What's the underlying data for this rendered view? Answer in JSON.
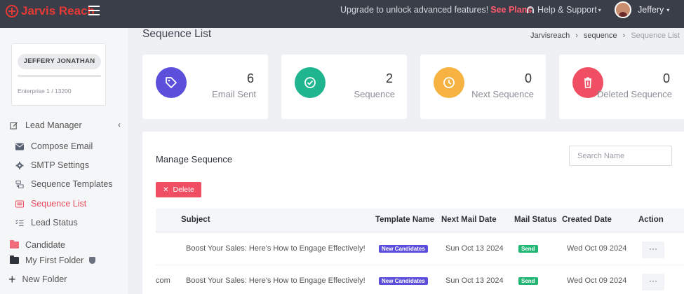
{
  "header": {
    "brand_name": "Jarvis Reach",
    "upgrade_text": "Upgrade to unlock advanced features!",
    "upgrade_link": "See Plans",
    "help_label": "Help & Support",
    "user_name": "Jeffery"
  },
  "sidebar": {
    "profile": {
      "name": "JEFFERY JONATHAN",
      "plan": "Enterprise 1 / 13200"
    },
    "section_label": "Lead Manager",
    "items": [
      {
        "label": "Compose Email",
        "icon": "envelope-icon"
      },
      {
        "label": "SMTP Settings",
        "icon": "gear-icon"
      },
      {
        "label": "Sequence Templates",
        "icon": "template-icon"
      },
      {
        "label": "Sequence List",
        "icon": "list-icon",
        "active": true
      },
      {
        "label": "Lead Status",
        "icon": "checklist-icon"
      }
    ],
    "folders": [
      {
        "label": "Candidate",
        "color": "#f26b7a"
      },
      {
        "label": "My First Folder",
        "color": "#2f333a"
      }
    ],
    "new_folder_label": "New Folder"
  },
  "page": {
    "title": "Sequence List",
    "breadcrumb": [
      "Jarvisreach",
      "sequence",
      "Sequence List"
    ]
  },
  "stats": [
    {
      "value": "6",
      "label": "Email Sent",
      "color": "#5b4fdb",
      "icon": "tag-icon"
    },
    {
      "value": "2",
      "label": "Sequence",
      "color": "#1fb58f",
      "icon": "check-circle-icon"
    },
    {
      "value": "0",
      "label": "Next Sequence",
      "color": "#f6b342",
      "icon": "clock-icon"
    },
    {
      "value": "0",
      "label": "Deleted Sequence",
      "color": "#ef4e63",
      "icon": "trash-icon"
    }
  ],
  "manage": {
    "title": "Manage Sequence",
    "search_placeholder": "Search Name",
    "delete_label": "Delete"
  },
  "table": {
    "columns": [
      "Subject",
      "Template Name",
      "Next Mail Date",
      "Mail Status",
      "Created Date",
      "Action"
    ],
    "rows": [
      {
        "prefix": "",
        "subject": "Boost Your Sales: Here's How to Engage Effectively!",
        "template": "New Candidates",
        "next_date": "Sun Oct 13 2024",
        "status": "Send",
        "created": "Wed Oct 09 2024",
        "action": "···"
      },
      {
        "prefix": "com",
        "subject": "Boost Your Sales: Here's How to Engage Effectively!",
        "template": "New Candidates",
        "next_date": "Sun Oct 13 2024",
        "status": "Send",
        "created": "Wed Oct 09 2024",
        "action": "···"
      }
    ]
  }
}
